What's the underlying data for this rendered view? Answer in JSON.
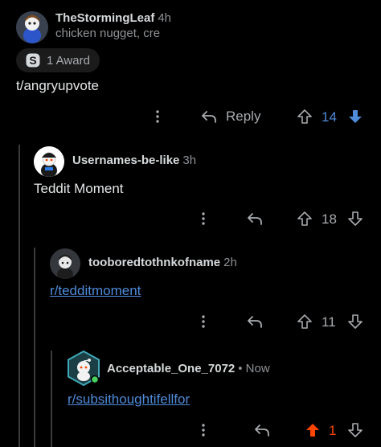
{
  "comments": [
    {
      "username": "TheStormingLeaf",
      "time": "4h",
      "flair": "chicken nugget, cre",
      "award": "1 Award",
      "body": "t/angryupvote",
      "reply_label": "Reply",
      "votes": "14",
      "vote_state": "downvoted",
      "vote_color": "#4f8bd9"
    },
    {
      "username": "Usernames-be-like",
      "time": "3h",
      "body": "Teddit Moment",
      "votes": "18",
      "vote_state": "none"
    },
    {
      "username": "tooboredtothnkofname",
      "time": "2h",
      "body": "r/tedditmoment",
      "votes": "11",
      "vote_state": "none"
    },
    {
      "username": "Acceptable_One_7072",
      "time": "• Now",
      "body": "r/subsithoughtifellfor",
      "votes": "1",
      "vote_state": "upvoted",
      "vote_color": "#ff4500"
    }
  ],
  "colors": {
    "background": "#000000",
    "text": "#d7dadc",
    "muted": "#8f9296",
    "link": "#4f8bd9",
    "upvote": "#ff4500",
    "downvote": "#4f8bd9",
    "online": "#46d160"
  },
  "icons": [
    "more-icon",
    "reply-icon",
    "upvote-icon",
    "downvote-icon",
    "award-icon"
  ]
}
